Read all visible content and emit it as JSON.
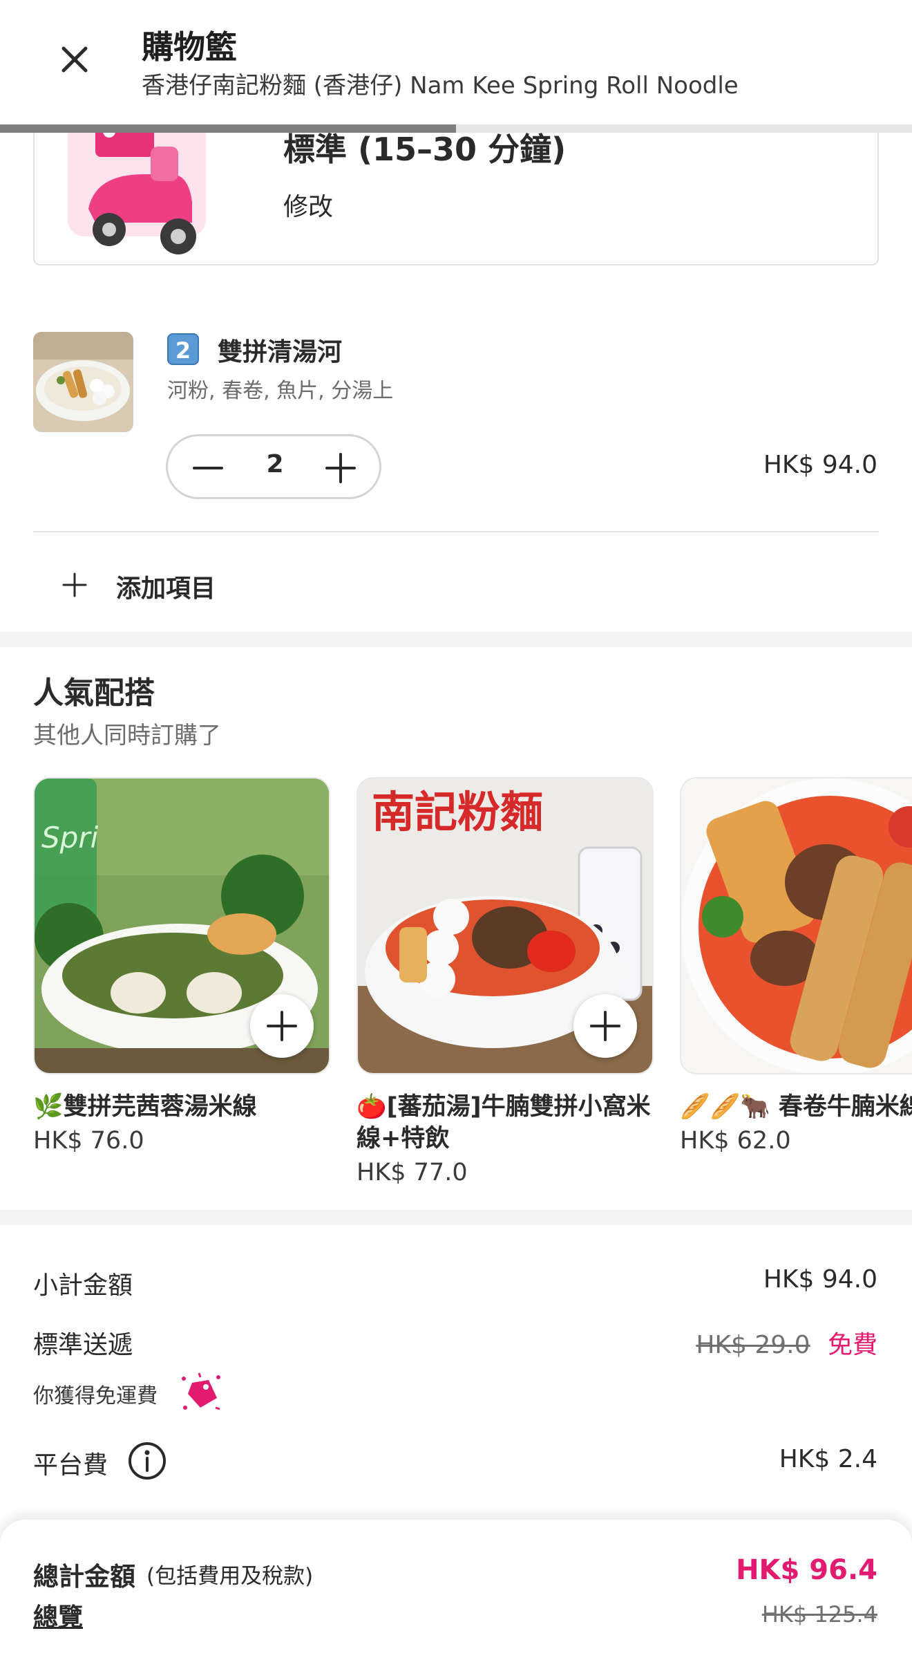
{
  "header": {
    "title": "購物籃",
    "subtitle": "香港仔南記粉麵 (香港仔) Nam Kee Spring Roll Noodle",
    "progress": 0.5
  },
  "delivery": {
    "time_label": "標準 (15–30 分鐘)",
    "edit_label": "修改"
  },
  "cart_item": {
    "badge": "2",
    "name": "雙拼清湯河",
    "options": "河粉, 春卷, 魚片, 分湯上",
    "quantity": "2",
    "price": "HK$ 94.0"
  },
  "add_more_label": "添加項目",
  "popular": {
    "title": "人氣配搭",
    "subtitle": "其他人同時訂購了",
    "items": [
      {
        "name": "🌿雙拼芫茜蓉湯米線",
        "price": "HK$ 76.0"
      },
      {
        "name": "🍅[蕃茄湯]牛腩雙拼小窩米線+特飲",
        "price": "HK$ 77.0"
      },
      {
        "name": "🥖🥖🐂 春卷牛腩米線",
        "price": "HK$ 62.0"
      }
    ],
    "image_text": "南記粉麵"
  },
  "summary": {
    "subtotal_label": "小計金額",
    "subtotal_value": "HK$ 94.0",
    "delivery_label": "標準送遞",
    "delivery_old": "HK$ 29.0",
    "delivery_new": "免費",
    "free_note": "你獲得免運費",
    "platform_label": "平台費",
    "platform_value": "HK$ 2.4"
  },
  "total": {
    "label": "總計金額",
    "note": "(包括費用及稅款)",
    "overview": "總覽",
    "value": "HK$ 96.4",
    "old_value": "HK$ 125.4"
  },
  "colors": {
    "accent": "#e21b70",
    "badge": "#5b9bd5"
  }
}
